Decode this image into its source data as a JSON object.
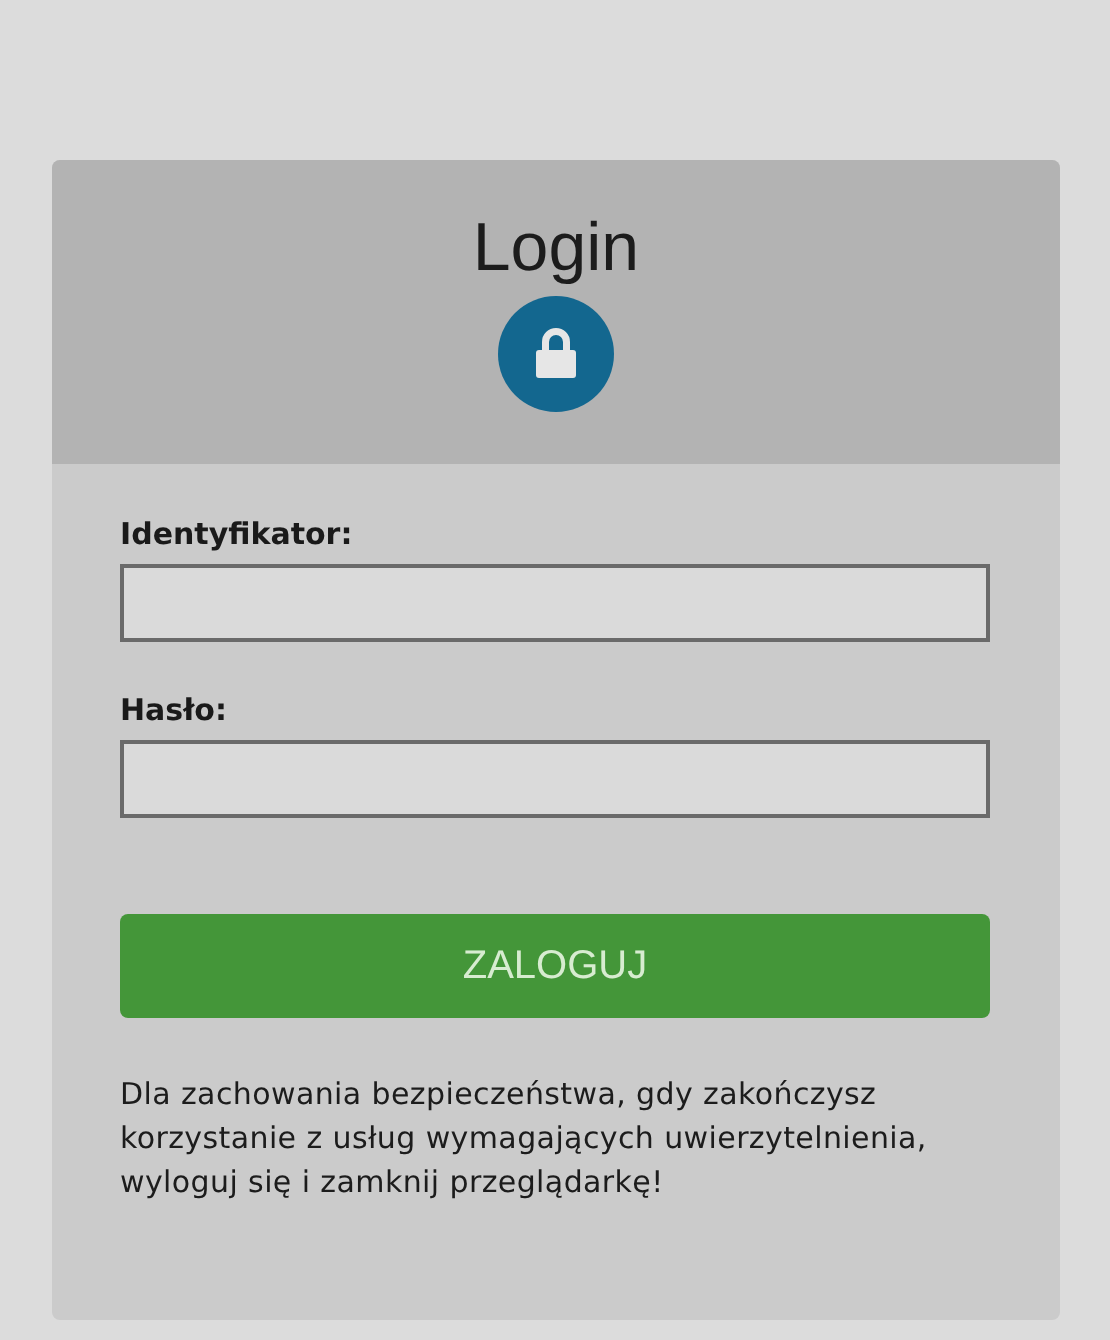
{
  "card": {
    "title": "Login"
  },
  "fields": [
    {
      "label": "Identyfikator:"
    },
    {
      "label": "Hasło:"
    }
  ],
  "button": {
    "label": "ZALOGUJ"
  },
  "notice": "Dla zachowania bezpieczeństwa, gdy zakończysz korzystanie z usług wymagających uwierzytelnienia, wyloguj się i zamknij przeglądarkę!"
}
